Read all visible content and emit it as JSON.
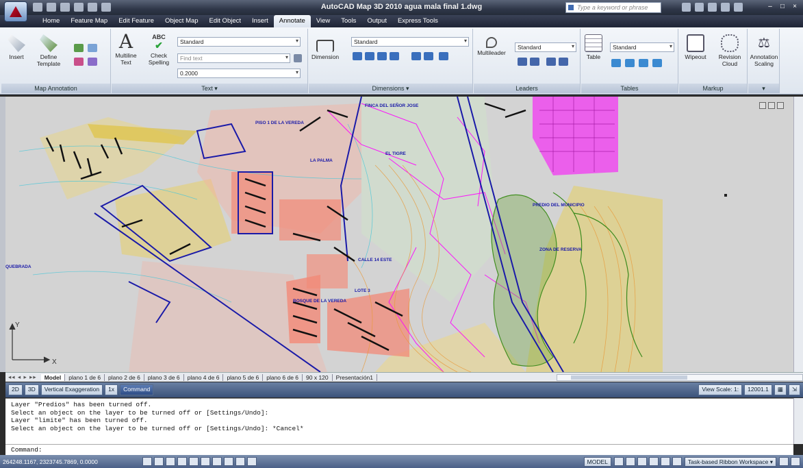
{
  "window": {
    "title": "AutoCAD Map 3D 2010   agua mala final 1.dwg",
    "search_placeholder": "Type a keyword or phrase",
    "controls": [
      "–",
      "□",
      "×"
    ]
  },
  "ribbon_tabs": [
    {
      "label": "Home",
      "active": false
    },
    {
      "label": "Feature Map",
      "active": false
    },
    {
      "label": "Edit Feature",
      "active": false
    },
    {
      "label": "Object Map",
      "active": false
    },
    {
      "label": "Edit Object",
      "active": false
    },
    {
      "label": "Insert",
      "active": false
    },
    {
      "label": "Annotate",
      "active": true
    },
    {
      "label": "View",
      "active": false
    },
    {
      "label": "Tools",
      "active": false
    },
    {
      "label": "Output",
      "active": false
    },
    {
      "label": "Express Tools",
      "active": false
    }
  ],
  "ribbon": {
    "map_annotation": {
      "title": "Map Annotation",
      "insert": "Insert",
      "define_template": "Define Template"
    },
    "text": {
      "title": "Text ▾",
      "multiline": "Multiline Text",
      "check_spelling": "Check Spelling",
      "style": "Standard",
      "find_placeholder": "Find text",
      "height": "0.2000"
    },
    "dimensions": {
      "title": "Dimensions ▾",
      "dimension": "Dimension",
      "style": "Standard"
    },
    "leaders": {
      "title": "Leaders",
      "multileader": "Multileader",
      "style": "Standard"
    },
    "tables": {
      "title": "Tables",
      "table": "Table",
      "style": "Standard"
    },
    "markup": {
      "title": "Markup",
      "wipeout": "Wipeout",
      "revision_cloud": "Revision Cloud"
    },
    "annotation_scaling": {
      "label": "Annotation Scaling"
    }
  },
  "map_labels": [
    "PISO 1 DE LA VEREDA",
    "FINCA DEL SEÑOR JOSE",
    "LA PALMA",
    "EL TIGRE",
    "PREDIO DEL MUNICIPIO",
    "ZONA DE RESERVA",
    "CALLE 14 ESTE",
    "LOTE 3",
    "QUEBRADA",
    "BOSQUE DE LA VEREDA"
  ],
  "layout_tabs": {
    "nav": "◂◂ ◂ ▸ ▸▸",
    "tabs": [
      {
        "label": "Model",
        "active": true
      },
      {
        "label": "plano 1 de 6",
        "active": false
      },
      {
        "label": "plano 2 de 6",
        "active": false
      },
      {
        "label": "plano 3 de 6",
        "active": false
      },
      {
        "label": "plano 4 de 6",
        "active": false
      },
      {
        "label": "plano 5 de 6",
        "active": false
      },
      {
        "label": "plano 6 de 6",
        "active": false
      },
      {
        "label": "90 x 120",
        "active": false
      },
      {
        "label": "Presentación1",
        "active": false
      }
    ]
  },
  "toolbar2": {
    "btn_2d": "2D",
    "btn_3d": "3D",
    "vertical_exaggeration": "Vertical Exaggeration",
    "exag_value": "1x",
    "command": "Command",
    "view_scale": "View Scale: 1:",
    "scale_value": "12001.1"
  },
  "command_history": [
    "Layer \"Predios\" has been turned off.",
    "Select an object on the layer to be turned off or [Settings/Undo]:",
    "Layer \"limite\" has been turned off.",
    "Select an object on the layer to be turned off or [Settings/Undo]: *Cancel*"
  ],
  "command_prompt": "Command:",
  "status": {
    "coordinates": "264248.1167, 2323745.7869, 0.0000",
    "model": "MODEL",
    "workspace": "Task-based Ribbon Workspace ▾"
  },
  "ucs": {
    "x_label": "X",
    "y_label": "Y"
  },
  "colors": {
    "canvas_bg": "#d3d3d3",
    "magenta": "#ff00ff",
    "salmon": "#f2876f",
    "blue": "#1a1aa8",
    "yellow": "#e8d040",
    "green": "#3a8a1c",
    "cyan": "#4cc7d8"
  }
}
